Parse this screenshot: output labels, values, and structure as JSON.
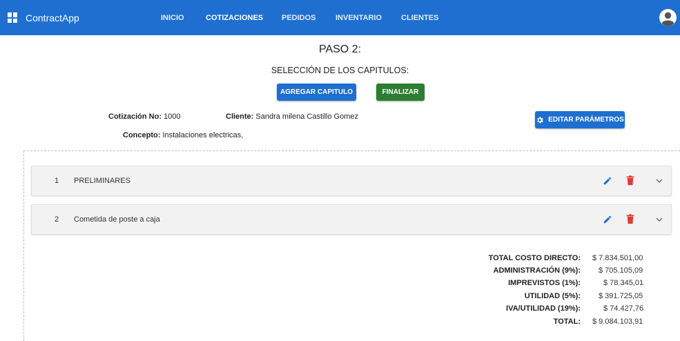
{
  "app": {
    "name": "ContractApp"
  },
  "nav": {
    "items": [
      "INICIO",
      "COTIZACIONES",
      "PEDIDOS",
      "INVENTARIO",
      "CLIENTES"
    ],
    "active": "COTIZACIONES"
  },
  "colors": {
    "primary": "#1e6fd0",
    "success": "#2e7d32",
    "danger": "#e53935",
    "panel": "#f2f2f2"
  },
  "header": {
    "step": "PASO 2:",
    "subtitle": "SELECCIÓN DE LOS CAPITULOS:",
    "add_button": "AGREGAR CAPITULO",
    "finish_button": "FINALIZAR",
    "edit_params_button": "EDITAR PARÁMETROS"
  },
  "quote": {
    "number_label": "Cotización No:",
    "number": "1000",
    "client_label": "Cliente:",
    "client": "Sandra milena Castillo Gomez",
    "concept_label": "Concepto:",
    "concept": "Instalaciones electricas,"
  },
  "chapters": [
    {
      "num": "1",
      "name": "PRELIMINARES"
    },
    {
      "num": "2",
      "name": "Cometida de poste a caja"
    }
  ],
  "icons": {
    "menu": "grid-icon",
    "avatar": "user-avatar-icon",
    "settings": "gear-icon",
    "edit": "pencil-icon",
    "delete": "trash-icon",
    "expand": "chevron-down-icon"
  },
  "totals": [
    {
      "label": "TOTAL COSTO DIRECTO:",
      "value": "$ 7.834.501,00"
    },
    {
      "label": "ADMINISTRACIÓN (9%):",
      "value": "$ 705.105,09"
    },
    {
      "label": "IMPREVISTOS (1%):",
      "value": "$ 78.345,01"
    },
    {
      "label": "UTILIDAD (5%):",
      "value": "$ 391.725,05"
    },
    {
      "label": "IVA/UTILIDAD (19%):",
      "value": "$ 74.427,76"
    },
    {
      "label": "TOTAL:",
      "value": "$ 9.084.103,91"
    }
  ]
}
